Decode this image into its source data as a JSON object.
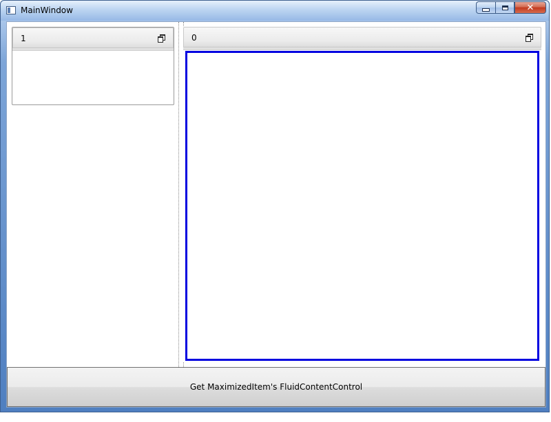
{
  "window": {
    "title": "MainWindow"
  },
  "panels": [
    {
      "id": "left",
      "header": "1"
    },
    {
      "id": "right",
      "header": "0"
    }
  ],
  "actions": {
    "get_button_label": "Get MaximizedItem's FluidContentControl"
  },
  "colors": {
    "selection_border": "#0000e0",
    "title_bar": "#97b9e6",
    "close_button": "#c2391e"
  }
}
